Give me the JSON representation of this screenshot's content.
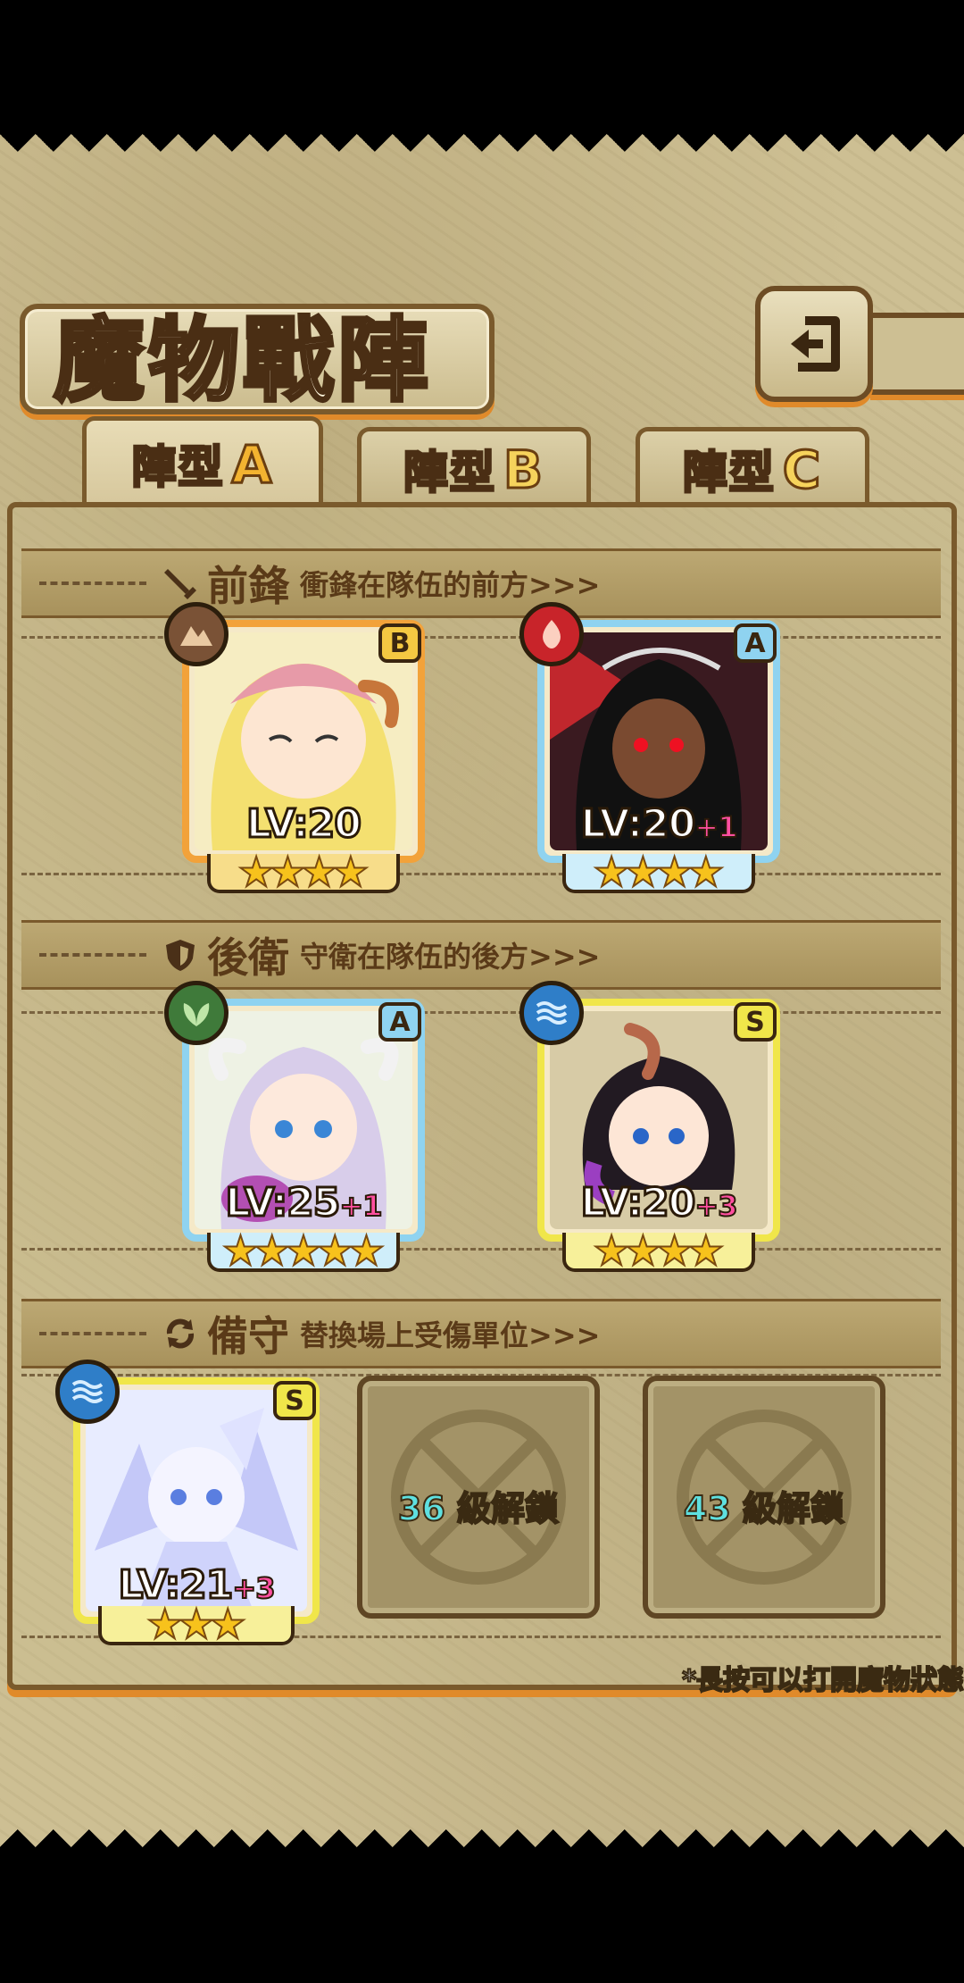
{
  "title": "魔物戰陣",
  "tabs": [
    {
      "label": "陣型",
      "letter": "A",
      "active": true
    },
    {
      "label": "陣型",
      "letter": "B",
      "active": false
    },
    {
      "label": "陣型",
      "letter": "C",
      "active": false
    }
  ],
  "sections": {
    "front": {
      "name": "前鋒",
      "desc": "衝鋒在隊伍的前方>>>"
    },
    "back": {
      "name": "後衛",
      "desc": "守衛在隊伍的後方>>>"
    },
    "reserve": {
      "name": "備守",
      "desc": "替換場上受傷單位>>>"
    }
  },
  "front_cards": [
    {
      "rank": "B",
      "element": "earth",
      "level": "LV:20",
      "bonus": "",
      "stars": 4,
      "frame": "#f2a23a"
    },
    {
      "rank": "A",
      "element": "fire",
      "level": "LV:20",
      "bonus": "+1",
      "stars": 4,
      "frame": "#8fd3f0"
    }
  ],
  "back_cards": [
    {
      "rank": "A",
      "element": "wood",
      "level": "LV:25",
      "bonus": "+1",
      "stars": 5,
      "frame": "#8fd3f0"
    },
    {
      "rank": "S",
      "element": "water",
      "level": "LV:20",
      "bonus": "+3",
      "stars": 4,
      "frame": "#f0e64a"
    }
  ],
  "reserve_card": {
    "rank": "S",
    "element": "water",
    "level": "LV:21",
    "bonus": "+3",
    "stars": 3,
    "frame": "#f0e64a"
  },
  "locked_slots": [
    {
      "level": "36",
      "text": "級解鎖"
    },
    {
      "level": "43",
      "text": "級解鎖"
    }
  ],
  "hint": "*長按可以打開魔物狀態"
}
